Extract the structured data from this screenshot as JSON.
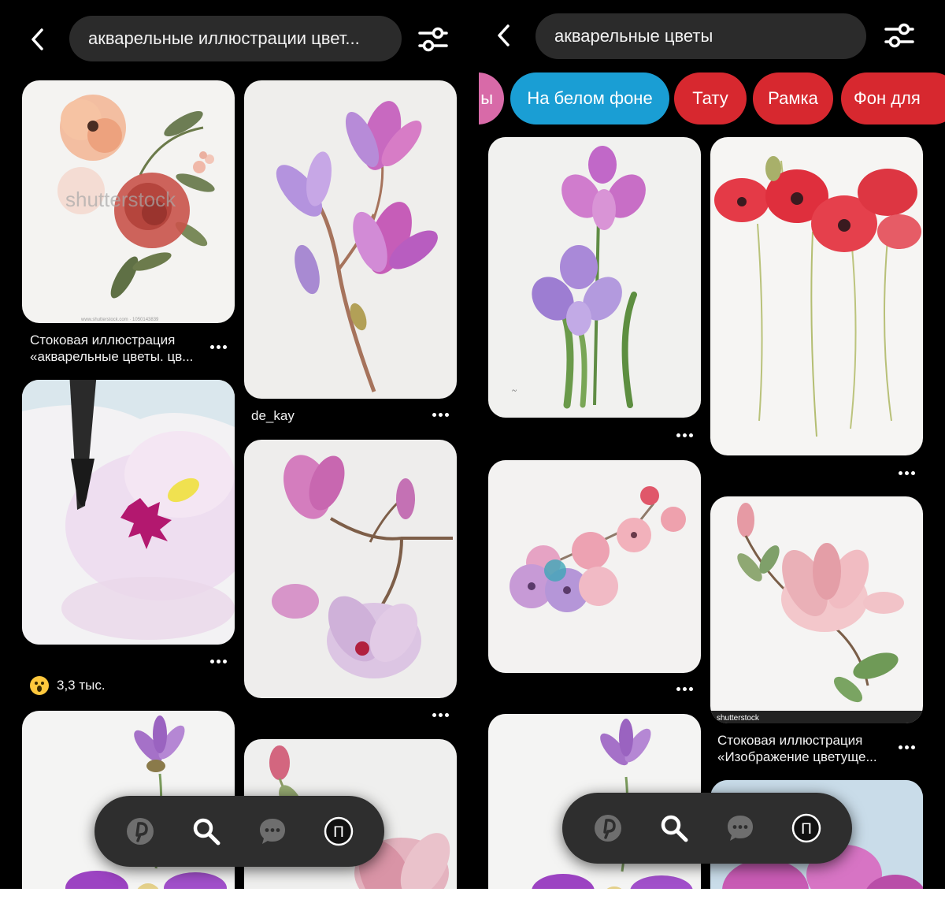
{
  "left": {
    "search_query": "акварельные иллюстрации цвет...",
    "pins": [
      {
        "caption": "Стоковая иллюстрация «акварельные цветы. цв...",
        "image": "peach and red roses watercolor"
      },
      {
        "caption": "de_kay",
        "image": "pink magnolia branch"
      },
      {
        "reaction_count": "3,3 тыс.",
        "image": "brush painting pink petal"
      },
      {
        "image": "pink magnolia sprig"
      },
      {
        "image": "purple clematis"
      },
      {
        "image": "pink magnolia bud"
      }
    ],
    "pin_watermarks": {
      "shutterstock": "shutterstock",
      "stock_id": "www.shutterstock.com · 1050143839"
    }
  },
  "right": {
    "search_query": "акварельные цветы",
    "chips": [
      {
        "label": "ы",
        "color": "#d86aa8"
      },
      {
        "label": "На белом фоне",
        "color": "#1a9ed4"
      },
      {
        "label": "Тату",
        "color": "#d7282f"
      },
      {
        "label": "Рамка",
        "color": "#d7282f"
      },
      {
        "label": "Фон для",
        "color": "#d7282f"
      }
    ],
    "pins": [
      {
        "image": "purple iris"
      },
      {
        "image": "red poppies"
      },
      {
        "image": "cherry blossom branch"
      },
      {
        "caption": "Стоковая иллюстрация «Изображение цветуще...",
        "image": "pink magnolia",
        "watermark": "shutterstock"
      },
      {
        "image": "purple clematis"
      },
      {
        "image": "pink peonies on blue"
      }
    ]
  },
  "nav": {
    "items": [
      "home-icon",
      "search-icon",
      "messages-icon",
      "profile-icon"
    ],
    "profile_letter": "П"
  },
  "colors": {
    "background": "#000000",
    "search_bg": "#2b2b2b",
    "nav_bg": "#2e2e2e",
    "chip_blue": "#1a9ed4",
    "chip_red": "#d7282f"
  }
}
